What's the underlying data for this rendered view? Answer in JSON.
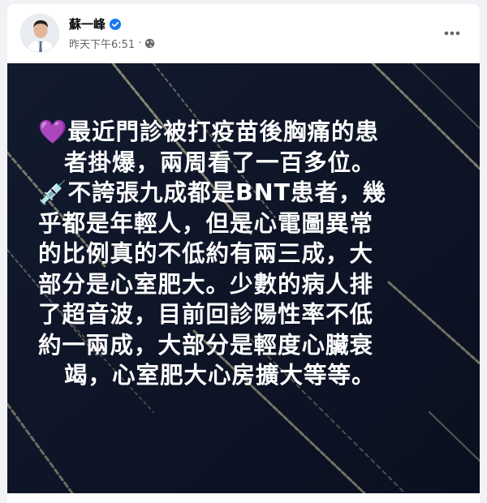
{
  "post": {
    "author": "蘇一峰",
    "timestamp": "昨天下午6:51",
    "separator": "·",
    "privacy_icon": "globe-icon",
    "verified_icon": "verified-badge-icon",
    "more_icon": "more-options-icon",
    "verified_color": "#1877f2"
  },
  "image_text": {
    "lines": [
      "💜最近門診被打疫苗後胸痛的患",
      "者掛爆，兩周看了一百多位。",
      "💉不誇張九成都是BNT患者，幾",
      "乎都是年輕人，但是心電圖異常",
      "的比例真的不低約有兩三成，大",
      "部分是心室肥大。少數的病人排",
      "了超音波，目前回診陽性率不低",
      "約一兩成，大部分是輕度心臟衰",
      "竭，心室肥大心房擴大等等。"
    ]
  },
  "colors": {
    "background": "#0f1526",
    "text": "#ffffff",
    "streak": "#c8c39a"
  }
}
